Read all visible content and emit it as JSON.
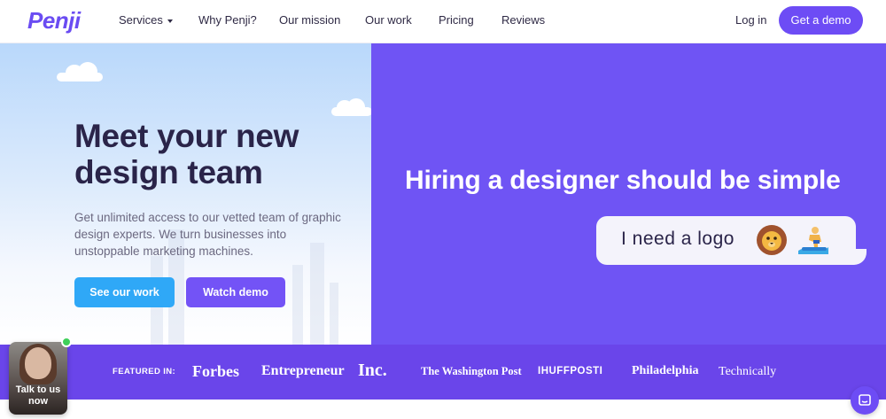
{
  "nav": {
    "logo": "Penji",
    "links": [
      "Services",
      "Why Penji?",
      "Our mission",
      "Our work",
      "Pricing",
      "Reviews"
    ],
    "login": "Log in",
    "cta": "Get a demo"
  },
  "hero": {
    "title": "Meet your new design team",
    "subtitle": "Get unlimited access to our vetted team of graphic design experts. We turn businesses into unstoppable marketing machines.",
    "primary_button": "See our work",
    "secondary_button": "Watch demo"
  },
  "promo": {
    "headline": "Hiring a designer should be simple",
    "bubble_text": "I need a logo",
    "bubble_icons": [
      "lion-emoji",
      "surfer-emoji"
    ]
  },
  "featured": {
    "label": "FEATURED IN:",
    "brands": [
      "Forbes",
      "Entrepreneur",
      "Inc.",
      "The Washington Post",
      "IHUFFPOSTI",
      "Philadelphia",
      "Technically"
    ]
  },
  "talk_widget": {
    "label": "Talk to us now"
  },
  "colors": {
    "brand_purple": "#6f54f4",
    "accent_blue": "#2fa8f7",
    "dark_text": "#2a2449"
  }
}
